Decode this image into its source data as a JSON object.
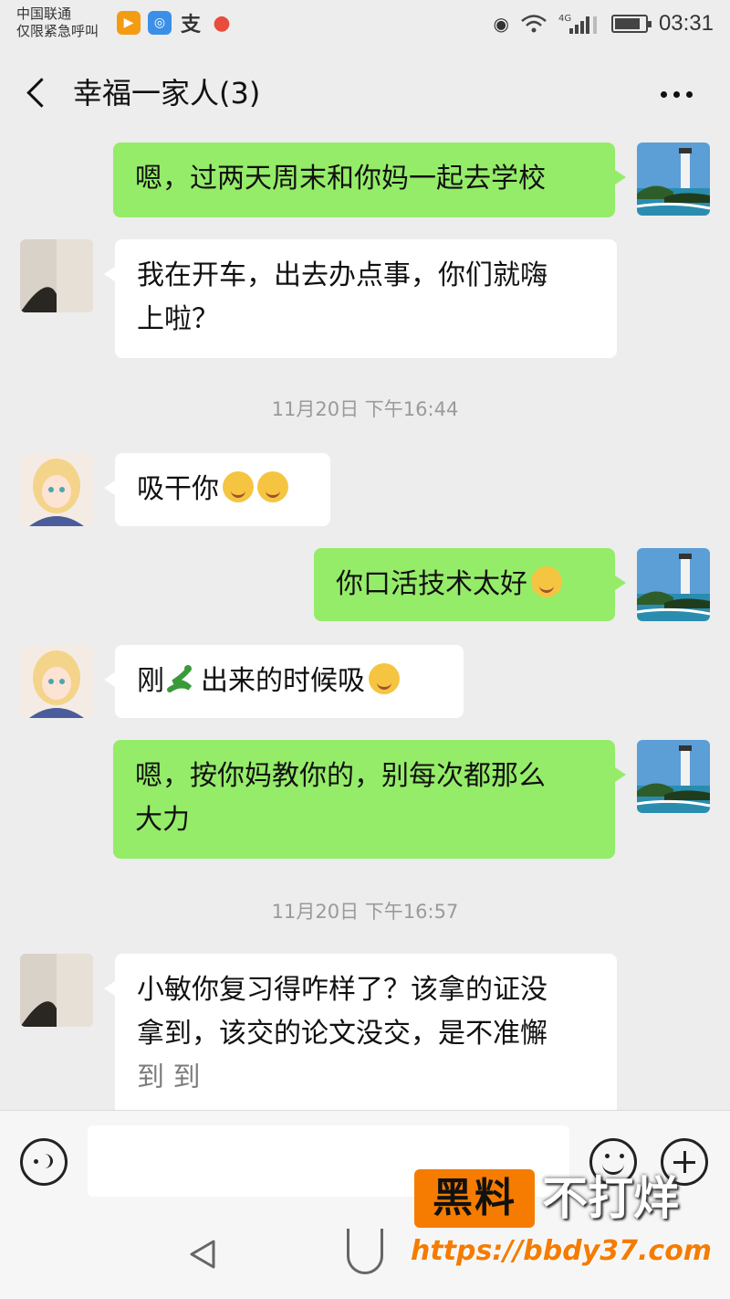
{
  "status_bar": {
    "carrier_line1": "中国联通",
    "carrier_line2": "仅限紧急呼叫",
    "network": "4G",
    "time": "03:31",
    "icons": [
      "video-app-icon",
      "voice-app-icon",
      "alipay-icon",
      "maps-icon",
      "eye-icon",
      "wifi-icon",
      "signal-icon",
      "battery-icon"
    ],
    "battery_level": 0.85
  },
  "header": {
    "title": "幸福一家人(3)",
    "back_icon": "chevron-left-icon",
    "more_icon": "more-dots-icon"
  },
  "messages": [
    {
      "side": "right",
      "text": "嗯，过两天周末和你妈一起去学校",
      "avatar": "lighthouse-avatar"
    },
    {
      "side": "left",
      "text_line1": "我在开车，出去办点事，你们就嗨",
      "text_line2": "上啦？",
      "avatar": "photo-avatar"
    },
    {
      "type": "timestamp",
      "text": "11月20日 下午16:44"
    },
    {
      "side": "left",
      "text": "吸干你",
      "emojis": [
        "thinking-face-emoji",
        "thinking-face-emoji"
      ],
      "avatar": "anime-girl-avatar"
    },
    {
      "side": "right",
      "text": "你口活技术太好",
      "emojis": [
        "laughing-crying-emoji"
      ],
      "avatar": "lighthouse-avatar"
    },
    {
      "side": "left",
      "text_before": "刚",
      "text_after": "出来的时候吸",
      "emojis": [
        "snake-emoji",
        "heart-eyes-emoji"
      ],
      "avatar": "anime-girl-avatar"
    },
    {
      "side": "right",
      "text_line1": "嗯，按你妈教你的，别每次都那么",
      "text_line2": "大力",
      "avatar": "lighthouse-avatar"
    },
    {
      "type": "timestamp",
      "text": "11月20日 下午16:57"
    },
    {
      "side": "left",
      "text_line1": "小敏你复习得咋样了？该拿的证没",
      "text_line2": "拿到，该交的论文没交，是不准懈",
      "text_line3": "到  到",
      "avatar": "photo-avatar"
    }
  ],
  "input_bar": {
    "voice_icon": "voice-icon",
    "emoji_icon": "smiley-icon",
    "plus_icon": "plus-icon",
    "input_value": ""
  },
  "nav_bar": {
    "icons": [
      "nav-back-icon",
      "nav-home-icon"
    ]
  },
  "watermark": {
    "box_text": "黑料",
    "text": "不打烊",
    "url": "https://bbdy37.com"
  },
  "colors": {
    "background": "#ededed",
    "bubble_sent": "#95ec69",
    "bubble_received": "#ffffff",
    "timestamp": "#9a9a9a",
    "watermark_orange": "#f57c00"
  }
}
